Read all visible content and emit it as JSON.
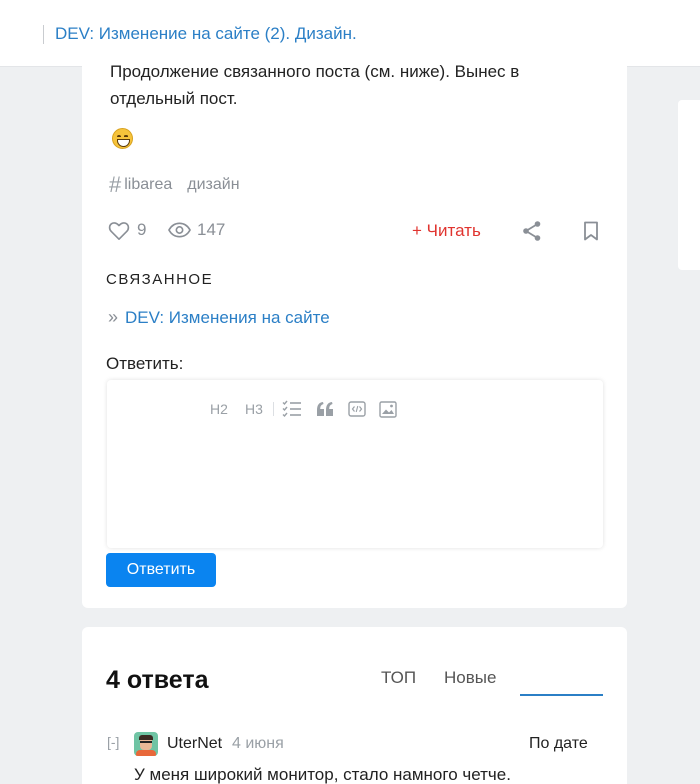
{
  "header": {
    "title": "DEV: Изменение на сайте (2). Дизайн."
  },
  "post": {
    "body_line1": "Продолжение связанного поста (см. ниже). Вынес в",
    "body_line2": "отдельный пост.",
    "emoji": "grinning-face-emoji",
    "tags": [
      "libarea",
      "дизайн"
    ],
    "likes": "9",
    "views": "147",
    "read_label": "+ Читать",
    "related_heading": "СВЯЗАННОЕ",
    "related_link": "DEV: Изменения на сайте",
    "reply_label": "Ответить:",
    "toolbar": {
      "h2": "H2",
      "h3": "H3"
    },
    "reply_button": "Ответить"
  },
  "answers": {
    "title": "4 ответа",
    "sort": {
      "top": "ТОП",
      "new": "Новые",
      "date": "По дате",
      "active": "date"
    },
    "comments": [
      {
        "collapse": "[-]",
        "author": "UterNet",
        "date": "4 июня",
        "text": "У меня широкий монитор, стало намного четче."
      }
    ]
  },
  "colors": {
    "accent": "#2b7fc6",
    "read": "#e0342f",
    "button": "#0a84f0"
  }
}
